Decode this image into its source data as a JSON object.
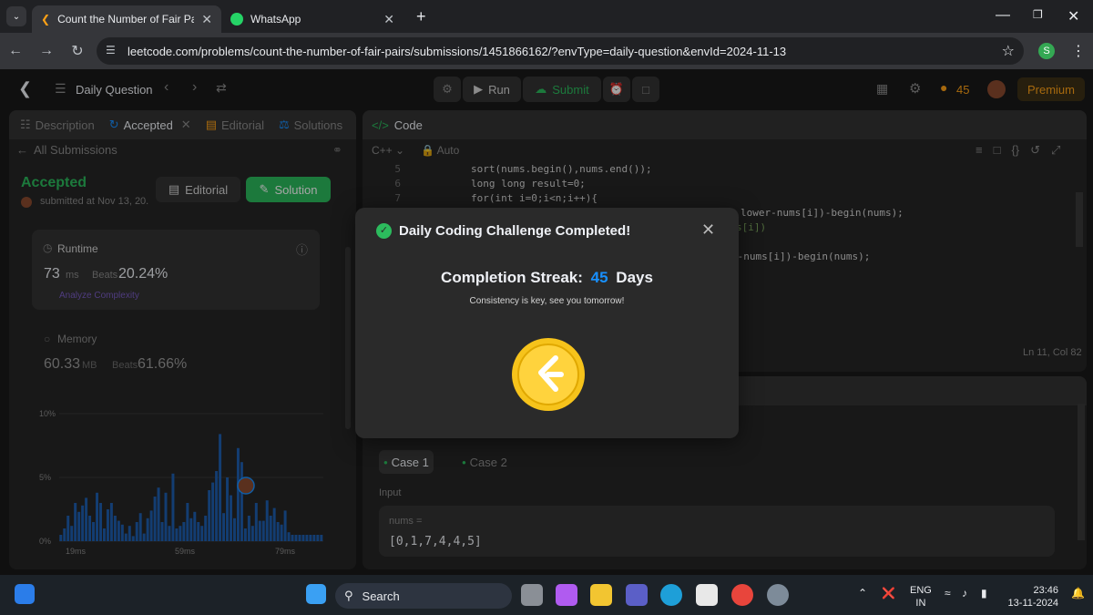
{
  "browser": {
    "tabs": [
      {
        "title": "Count the Number of Fair Pairs",
        "active": true
      },
      {
        "title": "WhatsApp",
        "active": false
      }
    ],
    "url": "leetcode.com/problems/count-the-number-of-fair-pairs/submissions/1451866162/?envType=daily-question&envId=2024-11-13",
    "profile_initial": "S"
  },
  "leetcode": {
    "daily_label": "Daily Question",
    "run_label": "Run",
    "submit_label": "Submit",
    "streak_count": "45",
    "premium_label": "Premium"
  },
  "left_panel": {
    "tabs": [
      "Description",
      "Accepted",
      "Editorial",
      "Solutions"
    ],
    "back_label": "All Submissions",
    "status": "Accepted",
    "submitted": "submitted at Nov 13, 20.",
    "editorial_btn": "Editorial",
    "solution_btn": "Solution",
    "runtime_label": "Runtime",
    "runtime_value": "73",
    "runtime_unit": "ms",
    "beats_label": "Beats",
    "runtime_beats": "20.24%",
    "analyze_label": "Analyze Complexity",
    "memory_label": "Memory",
    "memory_value": "60.33",
    "memory_unit": "MB",
    "memory_beats": "61.66%",
    "chart": {
      "yticks": [
        "10%",
        "5%",
        "0%"
      ],
      "xticks": [
        "19ms",
        "59ms",
        "79ms"
      ]
    }
  },
  "chart_data": {
    "type": "bar",
    "ylim": [
      0,
      10
    ],
    "values": [
      0.5,
      1,
      2,
      1.2,
      3,
      2.3,
      2.8,
      3.4,
      2,
      1.5,
      3.8,
      3,
      1,
      2.5,
      3,
      2,
      1.6,
      1.3,
      0.6,
      1.2,
      0.4,
      1.5,
      2.2,
      0.6,
      1.8,
      2.4,
      3.5,
      4.2,
      1.5,
      3.8,
      1.2,
      5.3,
      1,
      1.2,
      1.5,
      3,
      1.8,
      2.3,
      1.5,
      1.2,
      2,
      4,
      4.6,
      5.5,
      8.4,
      2.2,
      5,
      3.6,
      1.8,
      7.3,
      6.2,
      1,
      2,
      1.2,
      3,
      1.6,
      1.6,
      3.2,
      2,
      2.6,
      1.5,
      1.3,
      2.4,
      0.7,
      0.5,
      0.5,
      0.5,
      0.5,
      0.5,
      0.5,
      0.5,
      0.5,
      0.5
    ],
    "yticks": [
      "10%",
      "5%",
      "0%"
    ],
    "xticks": [
      "19ms",
      "59ms",
      "79ms"
    ]
  },
  "code_panel": {
    "title": "Code",
    "language": "C++",
    "mode": "Auto",
    "lines": [
      {
        "n": "5",
        "text": "        sort(nums.begin(),nums.end());"
      },
      {
        "n": "6",
        "text": "        long long result=0;"
      },
      {
        "n": "7",
        "text": "        for(int i=0;i<n;i++){"
      }
    ],
    "partial_lines": [
      "lower-nums[i])-begin(nums);",
      "s[i])",
      "r-nums[i])-begin(nums);"
    ],
    "cursor": "Ln 11, Col 82"
  },
  "testcase": {
    "cases": [
      "Case 1",
      "Case 2"
    ],
    "input_label": "Input",
    "var_label": "nums =",
    "var_value": "[0,1,7,4,4,5]"
  },
  "modal": {
    "title": "Daily Coding Challenge Completed!",
    "streak_label": "Completion Streak:",
    "streak_value": "45",
    "streak_unit": "Days",
    "message": "Consistency is key, see you tomorrow!"
  },
  "taskbar": {
    "search_placeholder": "Search",
    "lang_top": "ENG",
    "lang_bottom": "IN",
    "time": "23:46",
    "date": "13-11-2024"
  },
  "colors": {
    "accent_green": "#2cbb5d",
    "streak_blue": "#1890ff",
    "orange": "#ffa116"
  }
}
